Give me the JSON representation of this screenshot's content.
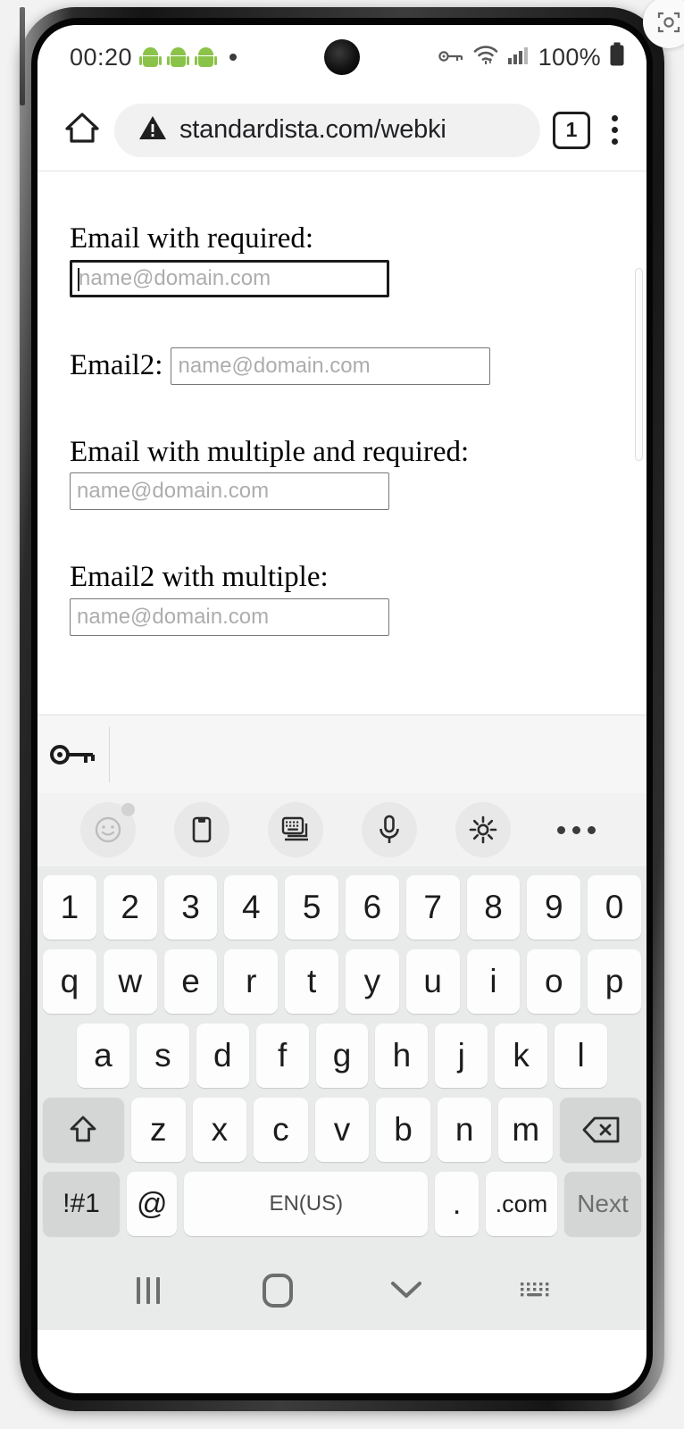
{
  "status_bar": {
    "clock": "00:20",
    "notification_icons": [
      "android-robot-icon",
      "android-robot-icon",
      "android-robot-icon",
      "notification-dot-icon"
    ],
    "vpn_icon": "vpn-key-icon",
    "wifi_icon": "wifi-icon",
    "signal_icon": "cellular-signal-icon",
    "battery_percent": "100%",
    "battery_icon": "battery-full-icon"
  },
  "browser": {
    "home_icon": "home-icon",
    "security_icon": "not-secure-warning-icon",
    "url": "standardista.com/webki",
    "tab_count": "1",
    "menu_icon": "overflow-menu-icon"
  },
  "page": {
    "fields": [
      {
        "label": "Email with required:",
        "placeholder": "name@domain.com",
        "focused": true
      },
      {
        "label": "Email2:",
        "placeholder": "name@domain.com",
        "focused": false,
        "inline": true
      },
      {
        "label": "Email with multiple and required:",
        "placeholder": "name@domain.com",
        "focused": false
      },
      {
        "label": "Email2 with multiple:",
        "placeholder": "name@domain.com",
        "focused": false
      }
    ]
  },
  "autofill_bar": {
    "key_icon": "password-key-icon"
  },
  "keyboard_toolbar": {
    "items": [
      {
        "icon": "emoji-sticker-icon",
        "badge": true,
        "circle": true
      },
      {
        "icon": "clipboard-icon",
        "circle": true
      },
      {
        "icon": "keyboard-mode-icon",
        "circle": true
      },
      {
        "icon": "microphone-icon",
        "circle": true
      },
      {
        "icon": "settings-gear-icon",
        "circle": true
      },
      {
        "icon": "more-options-icon",
        "circle": false
      }
    ]
  },
  "keyboard": {
    "row_numbers": [
      "1",
      "2",
      "3",
      "4",
      "5",
      "6",
      "7",
      "8",
      "9",
      "0"
    ],
    "row_top": [
      "q",
      "w",
      "e",
      "r",
      "t",
      "y",
      "u",
      "i",
      "o",
      "p"
    ],
    "row_home": [
      "a",
      "s",
      "d",
      "f",
      "g",
      "h",
      "j",
      "k",
      "l"
    ],
    "row_bottom_letters": [
      "z",
      "x",
      "c",
      "v",
      "b",
      "n",
      "m"
    ],
    "shift_icon": "shift-arrow-icon",
    "backspace_icon": "backspace-icon",
    "symbols_label": "!#1",
    "at_label": "@",
    "space_label": "EN(US)",
    "period_label": ".",
    "dotcom_label": ".com",
    "next_label": "Next"
  },
  "nav_bar": {
    "recents_icon": "recent-apps-icon",
    "home_icon": "home-button-icon",
    "hide_keyboard_icon": "chevron-down-icon",
    "keyboard_switch_icon": "keyboard-switcher-icon"
  },
  "floating": {
    "widget_icon": "screenshot-widget-icon"
  }
}
